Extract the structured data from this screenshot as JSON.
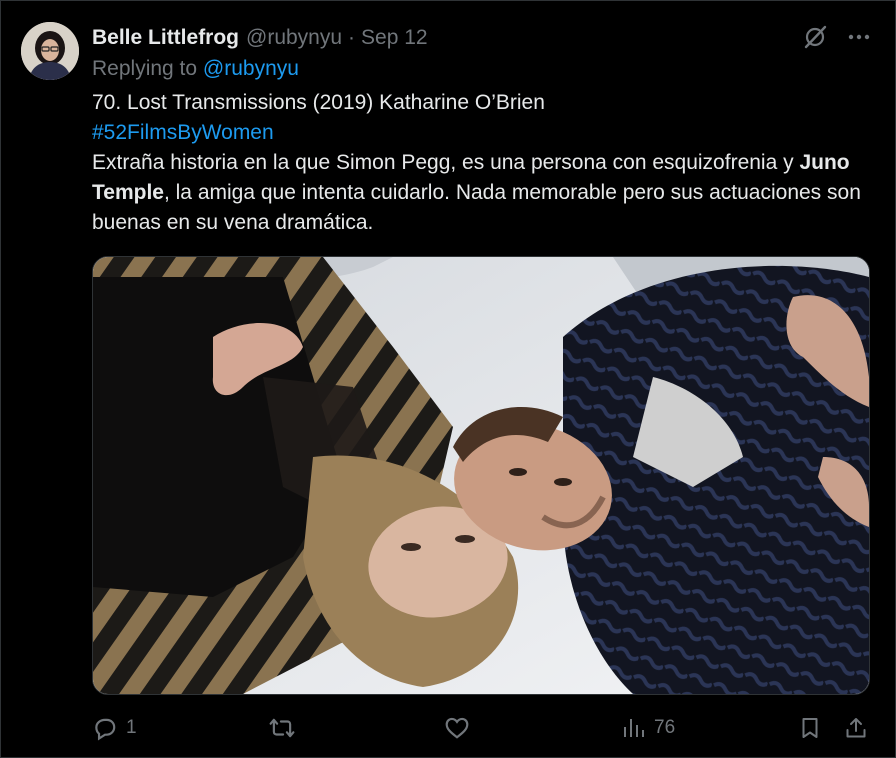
{
  "tweet": {
    "author": {
      "display_name": "Belle Littlefrog",
      "handle": "@rubynyu"
    },
    "separator": "·",
    "date": "Sep 12",
    "replying_to_prefix": "Replying to",
    "replying_to_handle": "@rubynyu",
    "text": {
      "line1": "70. Lost Transmissions (2019) Katharine O’Brien",
      "hashtag": "#52FilmsByWomen",
      "body_part1": "Extraña historia en la que Simon Pegg, es una persona con esquizofrenia y",
      "bold_name": "Juno Temple",
      "body_part2": ", la amiga que intenta cuidarlo.  Nada memorable pero sus actuaciones son buenas en su vena dramática."
    },
    "media": {
      "icon": "photo"
    },
    "actions": {
      "reply_count": "1",
      "retweet_count": "",
      "like_count": "",
      "view_count": "76"
    }
  },
  "colors": {
    "background": "#000000",
    "text": "#e7e9ea",
    "muted": "#71767b",
    "accent": "#1d9bf0",
    "border": "#2f3336"
  },
  "icons": [
    "grok-slash-icon",
    "more-icon",
    "reply-icon",
    "retweet-icon",
    "like-icon",
    "views-icon",
    "bookmark-icon",
    "share-icon"
  ]
}
